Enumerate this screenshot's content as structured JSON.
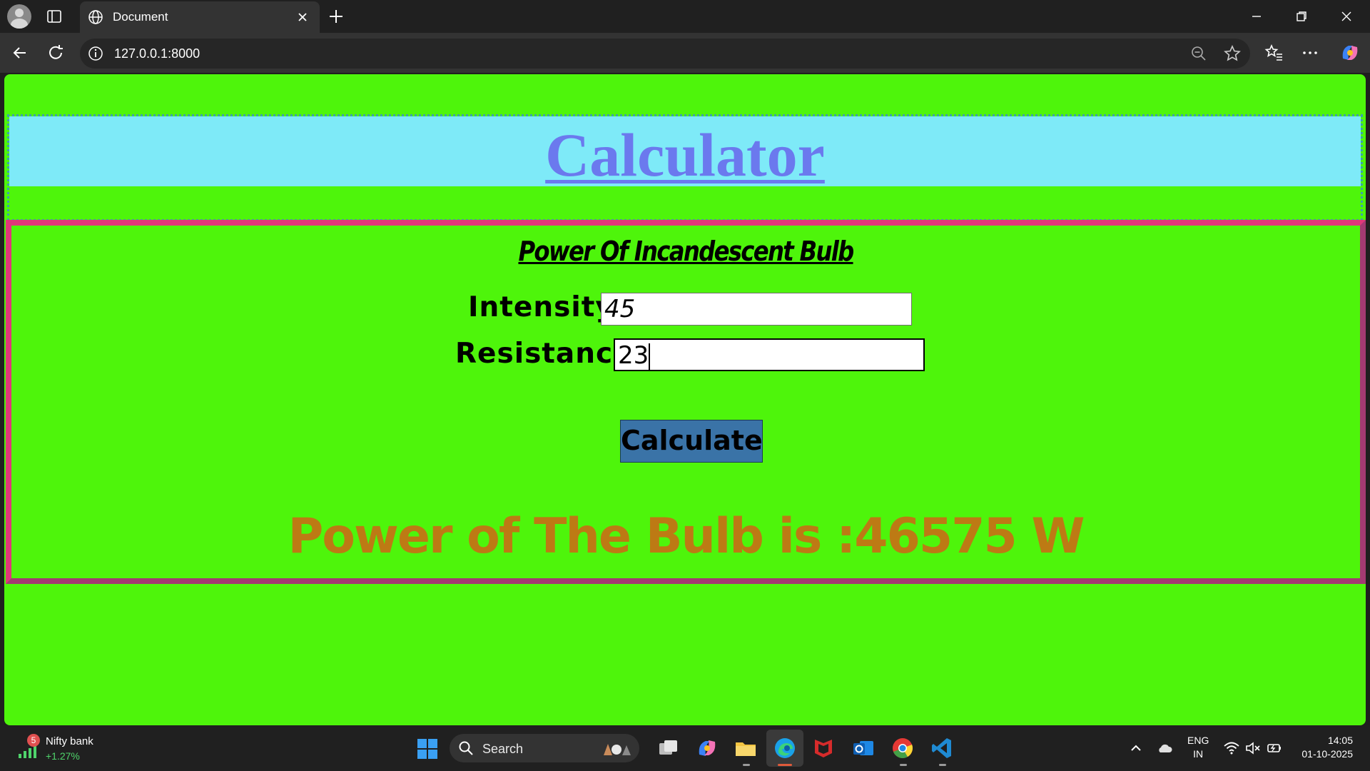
{
  "browser": {
    "tab_title": "Document",
    "url": "127.0.0.1:8000"
  },
  "page": {
    "title": "Calculator",
    "subtitle": "Power Of Incandescent Bulb",
    "fields": {
      "intensity_label": "Intensity:",
      "intensity_value": "45",
      "resistance_label": "Resistance:",
      "resistance_value": "23"
    },
    "button_label": "Calculate",
    "result_text": "Power of The Bulb is :46575 W"
  },
  "taskbar": {
    "widget_badge": "5",
    "widget_name": "Nifty bank",
    "widget_change": "+1.27%",
    "search_label": "Search",
    "lang_line1": "ENG",
    "lang_line2": "IN",
    "time": "14:05",
    "date": "01-10-2025"
  },
  "colors": {
    "page_background": "#4ef50b",
    "header_band": "#7eeaf8",
    "title": "#6b79ee",
    "calc_border": "#e0377a",
    "button": "#3a73a7",
    "result": "#bd7a14"
  }
}
